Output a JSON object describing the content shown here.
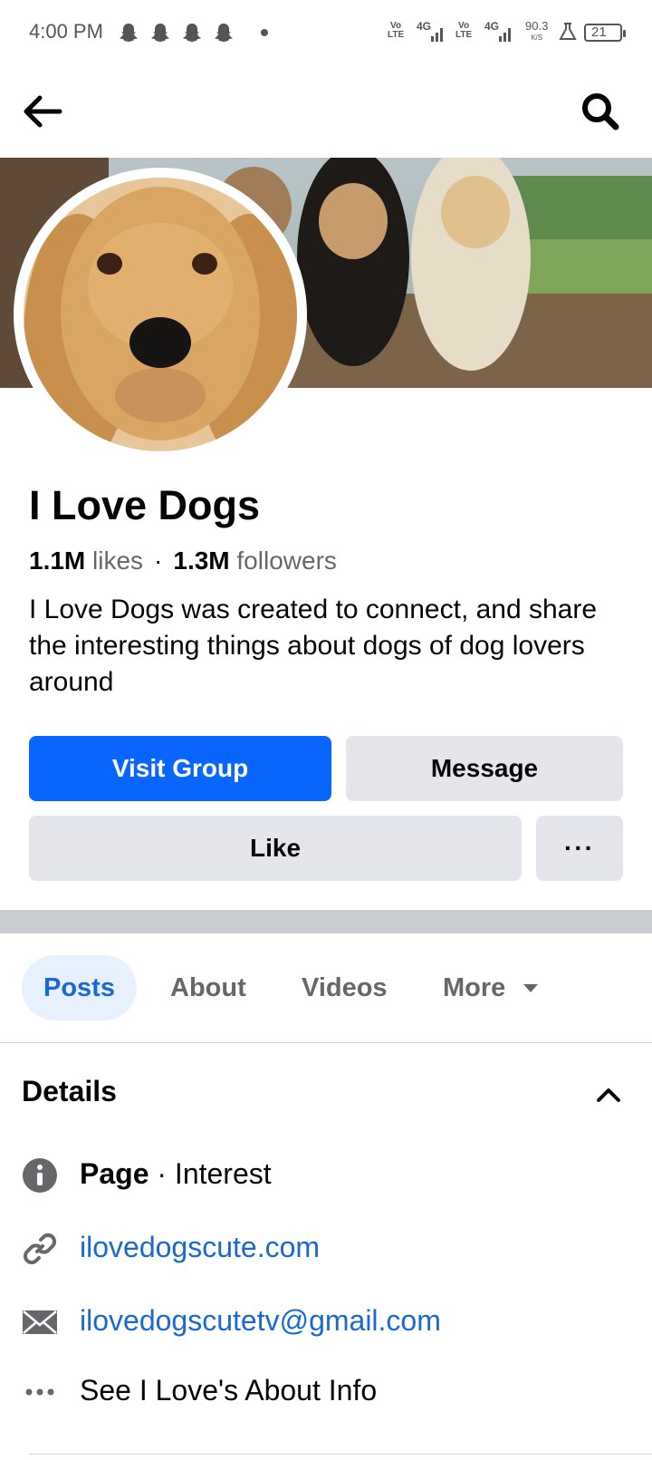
{
  "status_bar": {
    "time": "4:00 PM",
    "notification_icons": [
      "snapchat-icon",
      "snapchat-icon",
      "snapchat-icon",
      "snapchat-icon"
    ],
    "sim1_label_top": "Vo",
    "sim1_label_bottom": "LTE",
    "sim1_network": "4G",
    "sim2_label_top": "Vo",
    "sim2_label_bottom": "LTE",
    "sim2_network": "4G",
    "speed_value": "90.3",
    "speed_unit": "K/S",
    "battery": "21"
  },
  "top_bar": {
    "back_icon": "arrow-left-icon",
    "search_icon": "search-icon"
  },
  "page": {
    "name": "I Love Dogs",
    "likes_count": "1.1M",
    "likes_label": "likes",
    "followers_count": "1.3M",
    "followers_label": "followers",
    "separator": "·",
    "bio": "I Love Dogs was created to connect, and share the interesting things about dogs of dog lovers around"
  },
  "actions": {
    "visit_group": "Visit Group",
    "message": "Message",
    "like": "Like",
    "more": "···"
  },
  "tabs": [
    {
      "label": "Posts",
      "active": true
    },
    {
      "label": "About",
      "active": false
    },
    {
      "label": "Videos",
      "active": false
    },
    {
      "label": "More",
      "active": false
    }
  ],
  "details": {
    "title": "Details",
    "items": [
      {
        "icon": "info-icon",
        "bold": "Page",
        "text": " · Interest"
      },
      {
        "icon": "link-icon",
        "text": "ilovedogscute.com"
      },
      {
        "icon": "mail-icon",
        "text": "ilovedogscutetv@gmail.com"
      },
      {
        "icon": "ellipsis-icon",
        "text": "See I Love's About Info"
      }
    ]
  },
  "colors": {
    "accent": "#0866ff",
    "link": "#1a68d1",
    "secondary_button": "#e4e6eb",
    "muted_text": "#65676b"
  }
}
